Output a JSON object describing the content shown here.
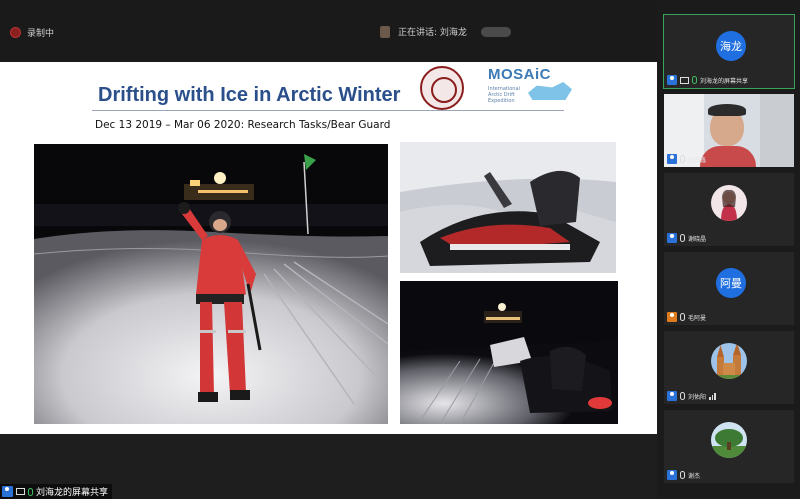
{
  "topbar": {
    "recording_label": "录制中",
    "speaking_label": "正在讲话: 刘海龙"
  },
  "slide": {
    "title": "Drifting with Ice in Arctic Winter",
    "subtitle": "Dec 13 2019 – Mar 06 2020: Research Tasks/Bear Guard",
    "logo_text": "MOSAiC",
    "logo_subtext": "International Arctic Drift Expedition"
  },
  "participants": [
    {
      "avatar_text": "海龙",
      "name": "刘海龙的屏幕共享",
      "avatar_type": "initials",
      "color": "#1f6fe0",
      "badge": "blue"
    },
    {
      "avatar_text": "",
      "name": "张兴鑫",
      "avatar_type": "video",
      "badge": "blue"
    },
    {
      "avatar_text": "",
      "name": "谢晓晶",
      "avatar_type": "photo-woman",
      "badge": "blue"
    },
    {
      "avatar_text": "阿曼",
      "name": "毛阿曼",
      "avatar_type": "initials",
      "color": "#1f6fe0",
      "badge": "orange"
    },
    {
      "avatar_text": "",
      "name": "刘佑阳",
      "avatar_type": "photo-church",
      "badge": "blue"
    },
    {
      "avatar_text": "",
      "name": "谢杰",
      "avatar_type": "photo-tree",
      "badge": "blue"
    }
  ],
  "screen_share_label": "刘海龙的屏幕共享",
  "colors": {
    "accent_blue": "#1f6fe0",
    "title_blue": "#2a4f8a",
    "active_border": "#36a55a",
    "host_orange": "#e07a1f"
  }
}
